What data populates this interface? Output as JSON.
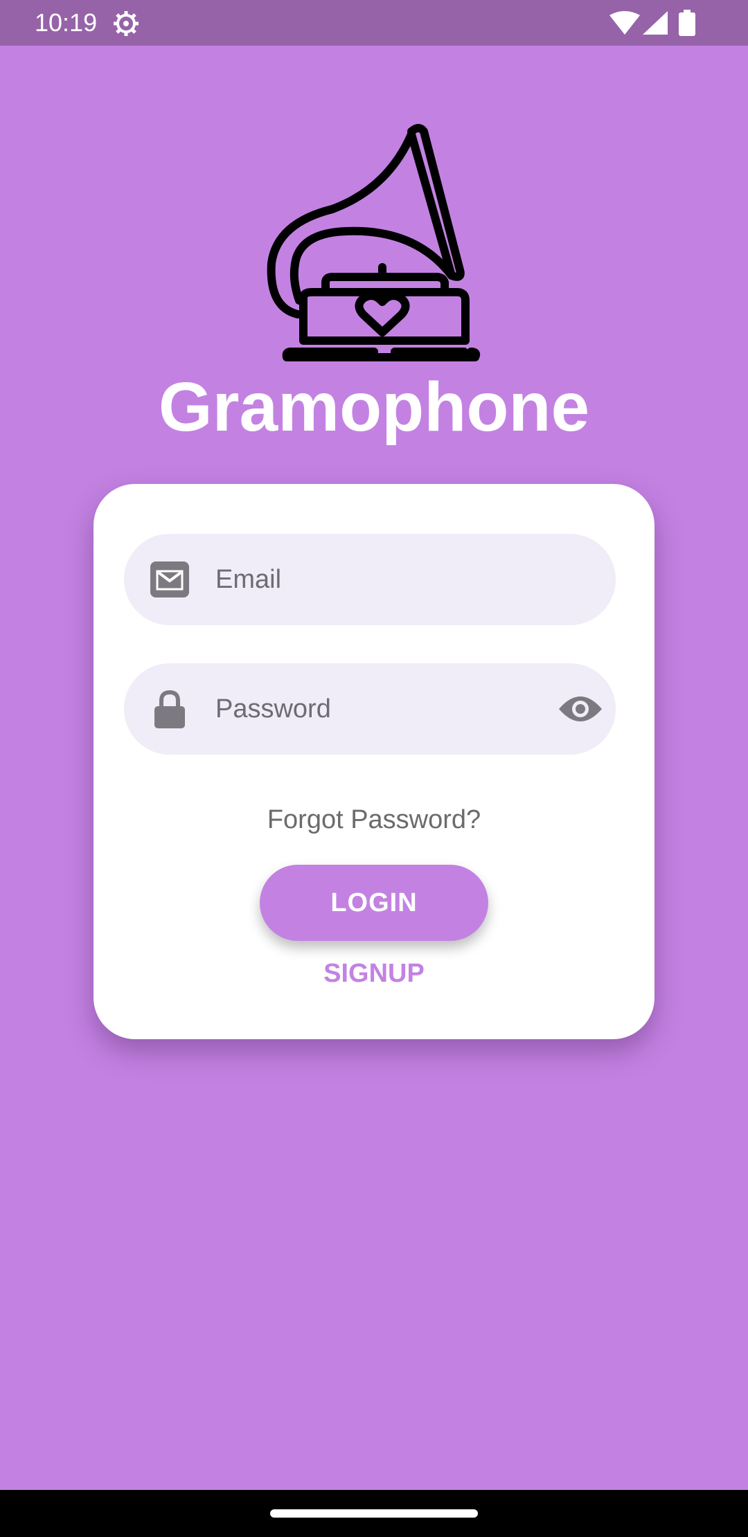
{
  "status_bar": {
    "time": "10:19",
    "icons": [
      "settings-gear-icon",
      "wifi-icon",
      "cell-signal-icon",
      "battery-icon"
    ]
  },
  "app": {
    "title": "Gramophone",
    "logo_icon": "gramophone-heart-icon"
  },
  "login_form": {
    "email": {
      "placeholder": "Email",
      "icon": "envelope-icon"
    },
    "password": {
      "placeholder": "Password",
      "icon": "lock-icon",
      "toggle_icon": "eye-icon"
    },
    "forgot_password_label": "Forgot Password?",
    "login_label": "LOGIN",
    "signup_label": "SIGNUP"
  },
  "colors": {
    "background": "#c382e2",
    "status_bar": "#9663a8",
    "card": "#ffffff",
    "field_bg": "#f0ecf8",
    "accent": "#c382e2"
  }
}
